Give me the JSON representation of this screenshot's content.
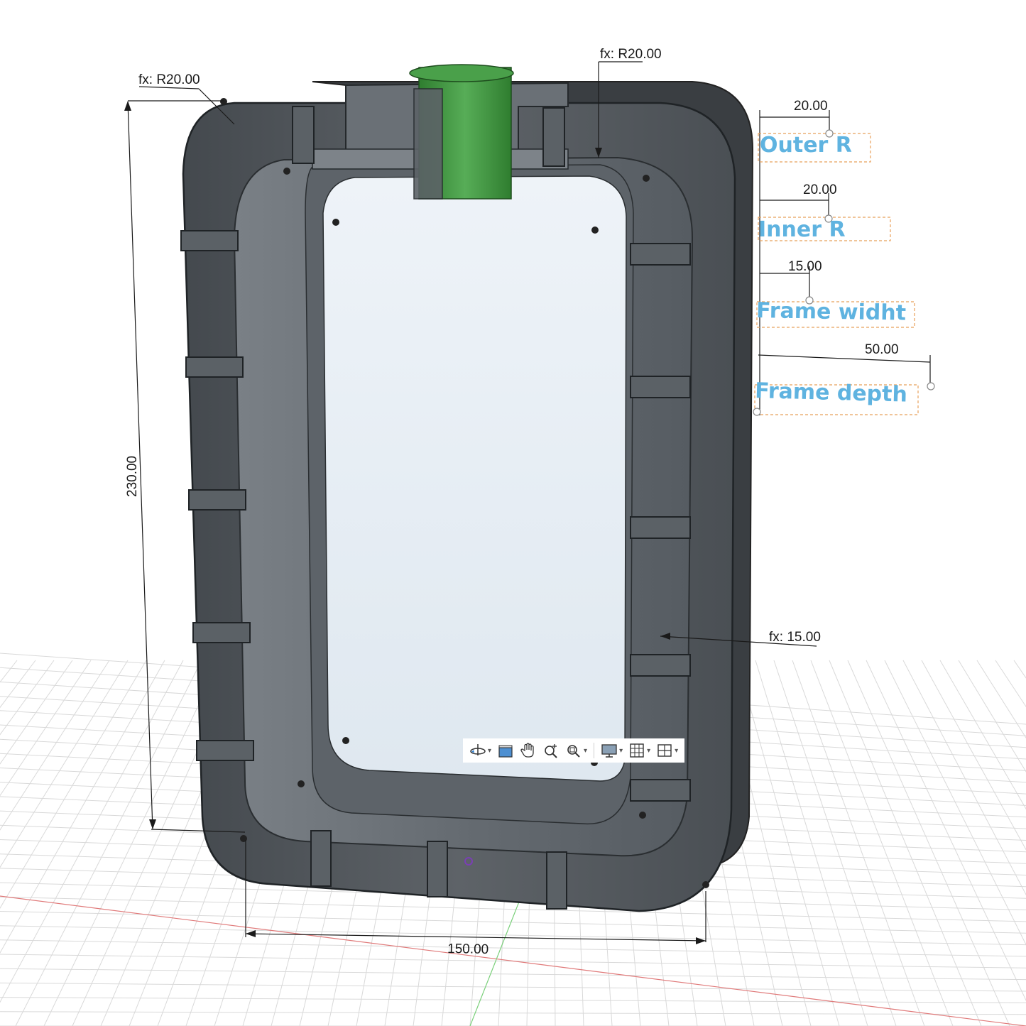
{
  "viewport": {
    "dimensions": {
      "top_left_formula": "fx: R20.00",
      "top_right_formula": "fx: R20.00",
      "right_formula": "fx: 15.00",
      "height": "230.00",
      "width": "150.00"
    },
    "parameters": [
      {
        "value": "20.00",
        "label": "Outer R"
      },
      {
        "value": "20.00",
        "label": "Inner R"
      },
      {
        "value": "15.00",
        "label": "Frame widht"
      },
      {
        "value": "50.00",
        "label": "Frame depth"
      }
    ],
    "colors": {
      "frame": "#4d5258",
      "frame_light": "#6b7075",
      "glass": "#e6eef5",
      "pipe": "#3f9a3f",
      "param_text": "#5fb3e0",
      "param_box": "#e8a05a",
      "grid": "#d9d9d9",
      "axis_x": "#e07a7a",
      "axis_y": "#7ad07a"
    }
  },
  "toolbar": {
    "tools": [
      {
        "icon": "orbit-icon",
        "has_menu": true
      },
      {
        "icon": "look-at-icon",
        "has_menu": false
      },
      {
        "icon": "pan-hand-icon",
        "has_menu": false
      },
      {
        "icon": "zoom-icon",
        "has_menu": false
      },
      {
        "icon": "fit-window-icon",
        "has_menu": true
      },
      {
        "icon": "display-settings-icon",
        "has_menu": true
      },
      {
        "icon": "grid-settings-icon",
        "has_menu": true
      },
      {
        "icon": "viewports-icon",
        "has_menu": true
      }
    ],
    "caret": "▾"
  }
}
